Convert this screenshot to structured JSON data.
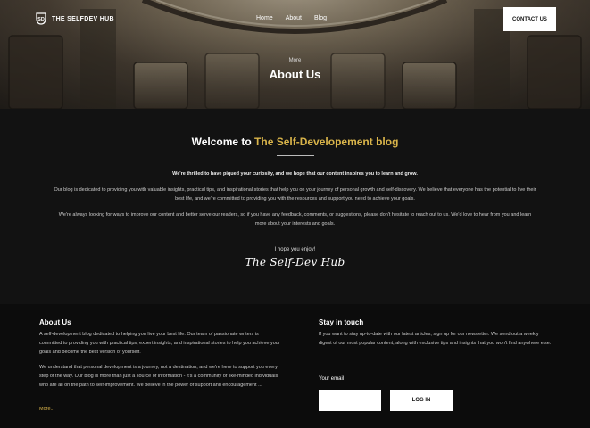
{
  "header": {
    "brand": "THE SELFDEV HUB",
    "nav": [
      "Home",
      "About",
      "Blog"
    ],
    "contact_label": "CONTACT US"
  },
  "hero": {
    "kicker": "More",
    "title": "About Us"
  },
  "welcome": {
    "heading_plain": "Welcome to ",
    "heading_accent": "The Self-Developement blog",
    "lead": "We're thrilled to have piqued your curiosity, and we hope that our content inspires you to learn and grow.",
    "para1": "Our blog is dedicated to providing you with valuable insights, practical tips, and inspirational stories that help you on your journey of personal growth and self-discovery. We believe that everyone has the potential to live their best life, and we're committed to providing you with the resources and support you need to achieve your goals.",
    "para2": "We're always looking for ways to improve our content and better serve our readers, so if you have any feedback, comments, or suggestions, please don't hesitate to reach out to us. We'd love to hear from you and learn more about your interests and goals.",
    "hope": "I hope you enjoy!",
    "signature": "The Self-Dev Hub"
  },
  "footer": {
    "about": {
      "heading": "About Us",
      "p1": "A self-development blog dedicated to helping you live your best life. Our team of passionate writers is committed to providing you with practical tips, expert insights, and inspirational stories to help you achieve your goals and become the best version of yourself.",
      "p2": "We understand that personal development is a journey, not a destination, and we're here to support you every step of the way. Our blog is more than just a source of information - it's a community of like-minded individuals who are all on the path to self-improvement. We believe in the power of support and encouragement ...",
      "more": "More..."
    },
    "stay": {
      "heading": "Stay in touch",
      "text": "If you want to stay up-to-date with our latest articles, sign up for our newsletter. We send out a weekly digest of our most popular content, along with exclusive tips and insights that you won't find anywhere else.",
      "email_label": "Your email",
      "email_value": "",
      "login_label": "LOG IN"
    }
  },
  "colors": {
    "accent": "#d9b44a",
    "background": "#121212",
    "footer_background": "#0c0c0c"
  },
  "icons": {
    "logo": "sd-monogram-logo"
  }
}
